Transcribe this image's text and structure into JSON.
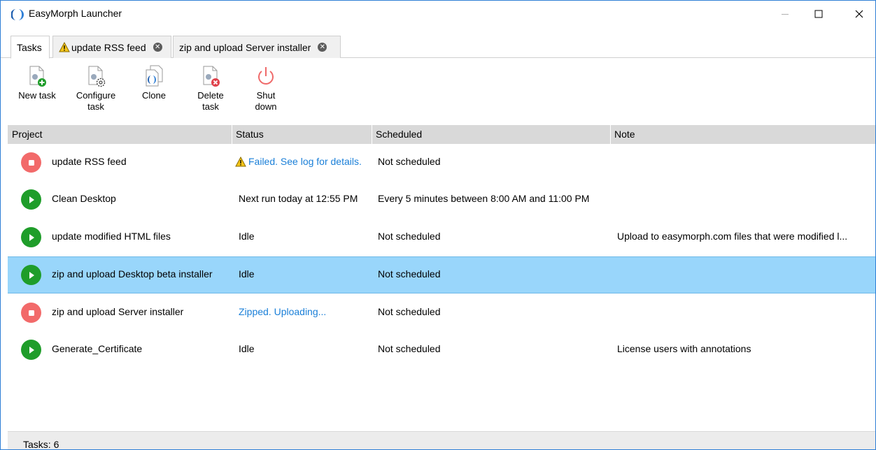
{
  "window": {
    "title": "EasyMorph Launcher"
  },
  "tabs": [
    {
      "label": "Tasks"
    },
    {
      "label": "update RSS feed",
      "icon": "warning-icon"
    },
    {
      "label": "zip and upload Server installer"
    }
  ],
  "toolbar": {
    "new_task": "New task",
    "configure_task": [
      "Configure",
      "task"
    ],
    "clone": "Clone",
    "delete_task": [
      "Delete",
      "task"
    ],
    "shut_down": [
      "Shut",
      "down"
    ]
  },
  "columns": [
    "Project",
    "Status",
    "Scheduled",
    "Note"
  ],
  "rows": [
    {
      "project": "update RSS feed",
      "status": "Failed. See log for details.",
      "scheduled": "Not scheduled",
      "note": "",
      "action": "stop",
      "status_style": "link",
      "warning": true
    },
    {
      "project": "Clean Desktop",
      "status": "Next run today at 12:55 PM",
      "scheduled": "Every 5 minutes between 8:00 AM and 11:00 PM",
      "note": "",
      "action": "play"
    },
    {
      "project": "update modified HTML files",
      "status": "Idle",
      "scheduled": "Not scheduled",
      "note": "Upload to easymorph.com files that were modified l...",
      "action": "play"
    },
    {
      "project": "zip and upload Desktop beta installer",
      "status": "Idle",
      "scheduled": "Not scheduled",
      "note": "",
      "action": "play",
      "selected": true
    },
    {
      "project": "zip and upload Server installer",
      "status": "Zipped. Uploading...",
      "scheduled": "Not scheduled",
      "note": "",
      "action": "stop",
      "status_style": "link"
    },
    {
      "project": "Generate_Certificate",
      "status": "Idle",
      "scheduled": "Not scheduled",
      "note": "License users with annotations",
      "action": "play"
    }
  ],
  "statusbar": {
    "text": "Tasks: 6"
  },
  "colors": {
    "accent": "#1a7fd8",
    "selected_row": "#99d6fb",
    "stop": "#f26a6a",
    "play": "#1f9d2a",
    "header": "#d9d9d9"
  }
}
